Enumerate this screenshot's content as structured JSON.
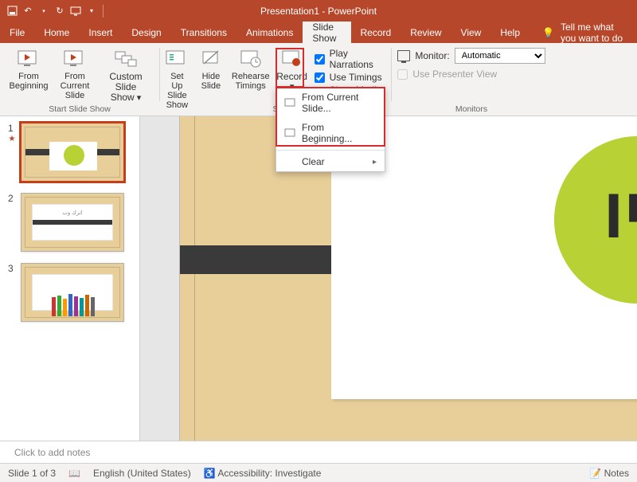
{
  "title": "Presentation1 - PowerPoint",
  "tabs": {
    "file": "File",
    "home": "Home",
    "insert": "Insert",
    "design": "Design",
    "transitions": "Transitions",
    "animations": "Animations",
    "slideshow": "Slide Show",
    "record": "Record",
    "review": "Review",
    "view": "View",
    "help": "Help",
    "tellme": "Tell me what you want to do"
  },
  "ribbon": {
    "from_beginning": "From Beginning",
    "from_current": "From Current Slide",
    "custom": "Custom Slide Show",
    "setup": "Set Up Slide Show",
    "hide": "Hide Slide",
    "rehearse": "Rehearse Timings",
    "record": "Record",
    "play_narr": "Play Narrations",
    "use_timings": "Use Timings",
    "show_media": "Show Media Controls",
    "monitor_lbl": "Monitor:",
    "monitor_val": "Automatic",
    "presenter": "Use Presenter View",
    "g_start": "Start Slide Show",
    "g_setup": "S",
    "g_mon": "Monitors"
  },
  "dropdown": {
    "from_current": "From Current Slide...",
    "from_beginning": "From Beginning...",
    "clear": "Clear"
  },
  "thumbs": {
    "n1": "1",
    "n2": "2",
    "n3": "3",
    "t2_text": "اترك وب"
  },
  "notes": "Click to add notes",
  "status": {
    "slide": "Slide 1 of 3",
    "lang": "English (United States)",
    "acc": "Accessibility: Investigate",
    "notes": "Notes"
  }
}
